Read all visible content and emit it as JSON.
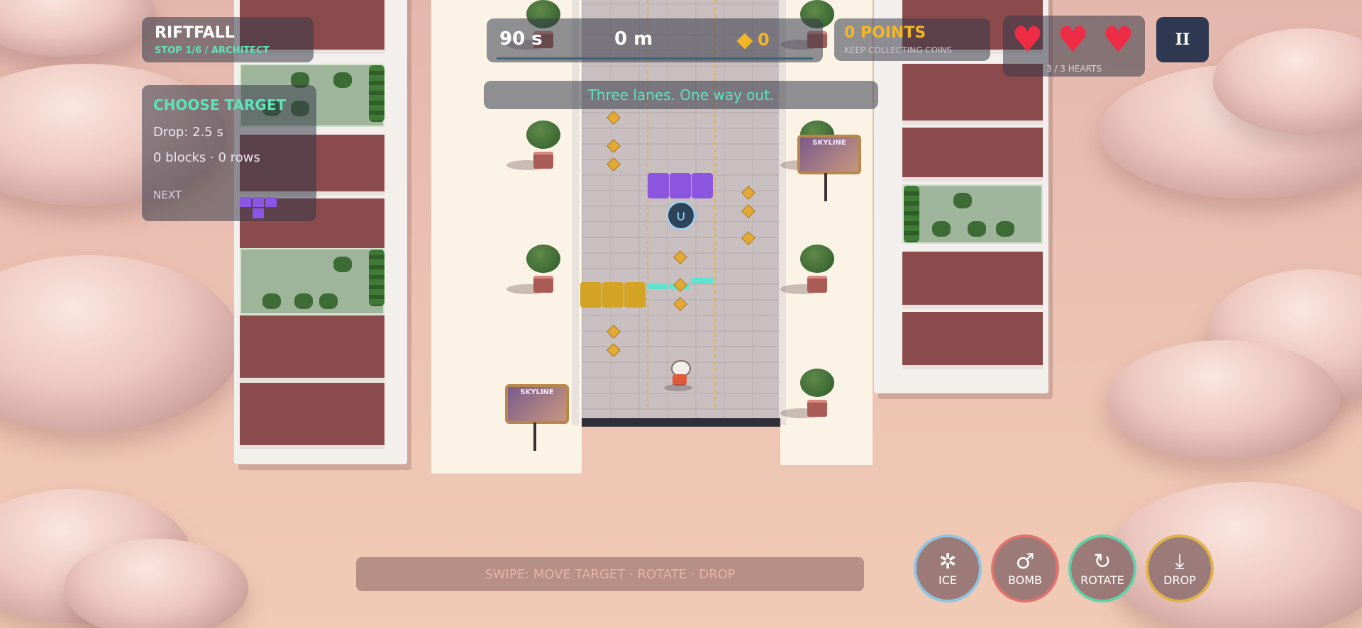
{
  "game": {
    "title": "RIFTFALL",
    "stage": "STOP 1/6 / ARCHITECT"
  },
  "target_panel": {
    "heading": "CHOOSE TARGET",
    "drop_label": "Drop: 2.5 s",
    "stats": "0 blocks · 0 rows",
    "next_label": "NEXT"
  },
  "top_bar": {
    "timer": "90 s",
    "distance": "0 m",
    "coins": "0"
  },
  "score": {
    "points": "0 POINTS",
    "hint": "KEEP COLLECTING COINS"
  },
  "hearts": {
    "caption": "3 / 3 HEARTS",
    "count": 3,
    "max": 3
  },
  "pause_button": {
    "glyph": "II"
  },
  "banner": {
    "text": "Three lanes. One way out."
  },
  "instructions": {
    "text": "SWIPE: MOVE TARGET · ROTATE · DROP"
  },
  "billboards": [
    {
      "label": "SKYLINE"
    },
    {
      "label": "SKYLINE"
    }
  ],
  "actions": [
    {
      "label": "ICE",
      "icon": "snowflake-icon",
      "ring": "#8fc3e0"
    },
    {
      "label": "BOMB",
      "icon": "bomb-icon",
      "ring": "#e0736f"
    },
    {
      "label": "ROTATE",
      "icon": "rotate-icon",
      "ring": "#63d2a8"
    },
    {
      "label": "DROP",
      "icon": "drop-icon",
      "ring": "#e0b24a"
    }
  ],
  "colors": {
    "accent": "#5fe3b8",
    "points": "#f2b526",
    "heart": "#ee2c46",
    "next_piece": "#8b55e6",
    "gold_block": "#d2a325"
  }
}
